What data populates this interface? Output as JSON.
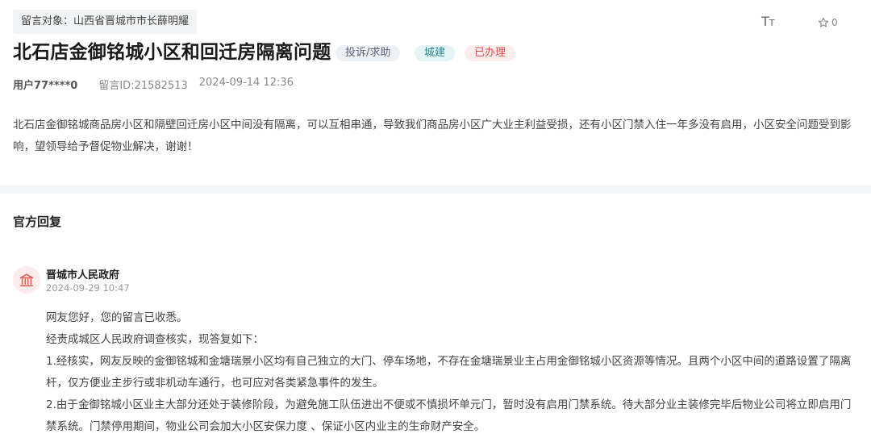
{
  "header": {
    "target_label": "留言对象：",
    "target_value": "山西省晋城市市长薛明耀",
    "font_toggle_big": "T",
    "font_toggle_small": "T",
    "favorite_count": "0"
  },
  "message": {
    "title": "北石店金御铭城小区和回迁房隔离问题",
    "tags": {
      "type": "投诉/求助",
      "field": "城建",
      "status": "已办理"
    },
    "user": "用户77****0",
    "message_id": "留言ID:21582513",
    "datetime": "2024-09-14 12:36",
    "content": "北石店金御铭城商品房小区和隔壁回迁房小区中间没有隔离，可以互相串通，导致我们商品房小区广大业主利益受损，还有小区门禁入住一年多没有启用，小区安全问题受到影响，望领导给予督促物业解决，谢谢！"
  },
  "reply": {
    "heading": "官方回复",
    "org": "晋城市人民政府",
    "time": "2024-09-29 10:47",
    "paragraphs": [
      "网友您好，您的留言已收悉。",
      "经责成城区人民政府调查核实，现答复如下：",
      "1.经核实，网友反映的金御铭城和金塘瑞景小区均有自己独立的大门、停车场地，不存在金塘瑞景业主占用金御铭城小区资源等情况。且两个小区中间的道路设置了隔离杆，仅方便业主步行或非机动车通行，也可应对各类紧急事件的发生。",
      "2.由于金御铭城小区业主大部分还处于装修阶段，为避免施工队伍进出不便或不慎损坏单元门，暂时没有启用门禁系统。待大部分业主装修完毕后物业公司将立即启用门禁系统。门禁停用期间，物业公司会加大小区安保力度 、保证小区内业主的生命财产安全。"
    ]
  },
  "colors": {
    "status_red": "#e04a4a",
    "field_teal": "#2b8a96",
    "divider_gray": "#f5f6f7"
  },
  "icons": [
    "font-size-icon",
    "star-icon",
    "government-building-icon"
  ]
}
